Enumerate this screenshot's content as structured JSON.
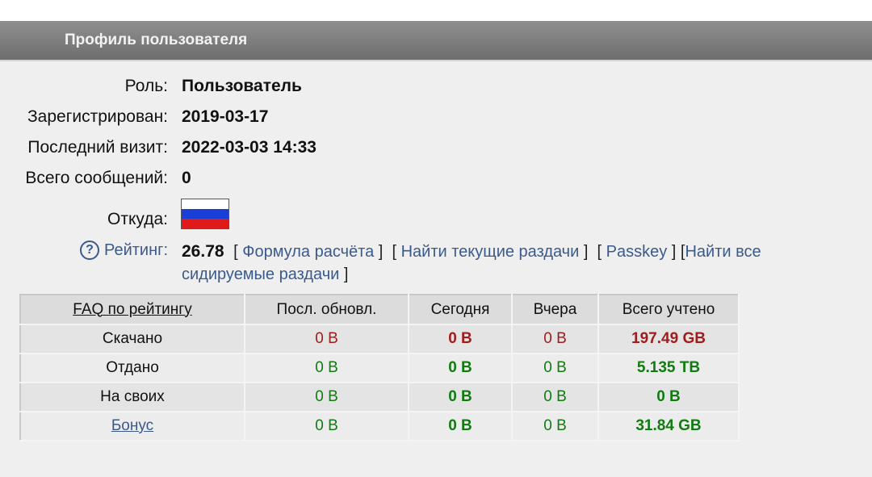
{
  "header": {
    "title": "Профиль пользователя"
  },
  "profile": {
    "role_label": "Роль:",
    "role_value": "Пользователь",
    "registered_label": "Зарегистрирован:",
    "registered_value": "2019-03-17",
    "last_visit_label": "Последний визит:",
    "last_visit_value": "2022-03-03 14:33",
    "messages_label": "Всего сообщений:",
    "messages_value": "0",
    "from_label": "Откуда:",
    "flag_colors": [
      "#ffffff",
      "#1a3fd6",
      "#e01a1a"
    ]
  },
  "rating": {
    "help_icon": "?",
    "label": "Рейтинг:",
    "value": "26.78",
    "link_formula": "Формула расчёта",
    "link_current": "Найти текущие раздачи",
    "link_passkey": "Passkey",
    "link_all": "Найти все сидируемые раздачи"
  },
  "stats": {
    "headers": [
      "FAQ по рейтингу",
      "Посл. обновл.",
      "Сегодня",
      "Вчера",
      "Всего учтено"
    ],
    "rows": [
      {
        "label": "Скачано",
        "last": "0 B",
        "today": "0 B",
        "yesterday": "0 B",
        "total": "197.49 GB"
      },
      {
        "label": "Отдано",
        "last": "0 B",
        "today": "0 B",
        "yesterday": "0 B",
        "total": "5.135 TB"
      },
      {
        "label": "На своих",
        "last": "0 B",
        "today": "0 B",
        "yesterday": "0 B",
        "total": "0 B"
      },
      {
        "label": "Бонус",
        "last": "0 B",
        "today": "0 B",
        "yesterday": "0 B",
        "total": "31.84 GB"
      }
    ]
  },
  "colors": {
    "link": "#3a5a8c",
    "download": "#a01d1d",
    "upload": "#117a11"
  }
}
